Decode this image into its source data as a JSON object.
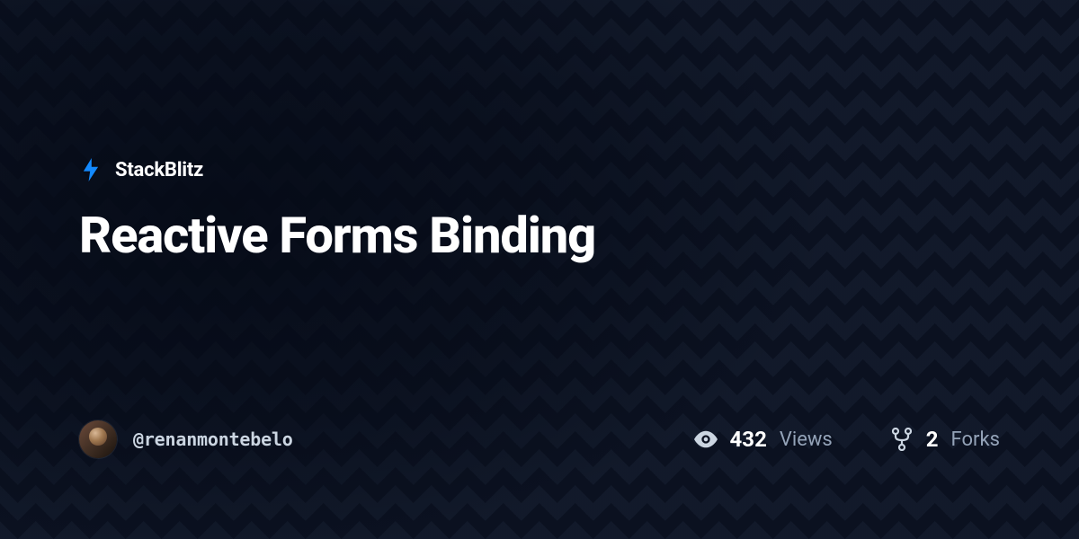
{
  "brand": {
    "name": "StackBlitz",
    "icon": "bolt-icon",
    "accent_color": "#1389FD"
  },
  "project": {
    "title": "Reactive Forms Binding"
  },
  "author": {
    "username": "@renanmontebelo"
  },
  "stats": {
    "views": {
      "icon": "eye-icon",
      "value": "432",
      "label": "Views"
    },
    "forks": {
      "icon": "fork-icon",
      "value": "2",
      "label": "Forks"
    }
  }
}
